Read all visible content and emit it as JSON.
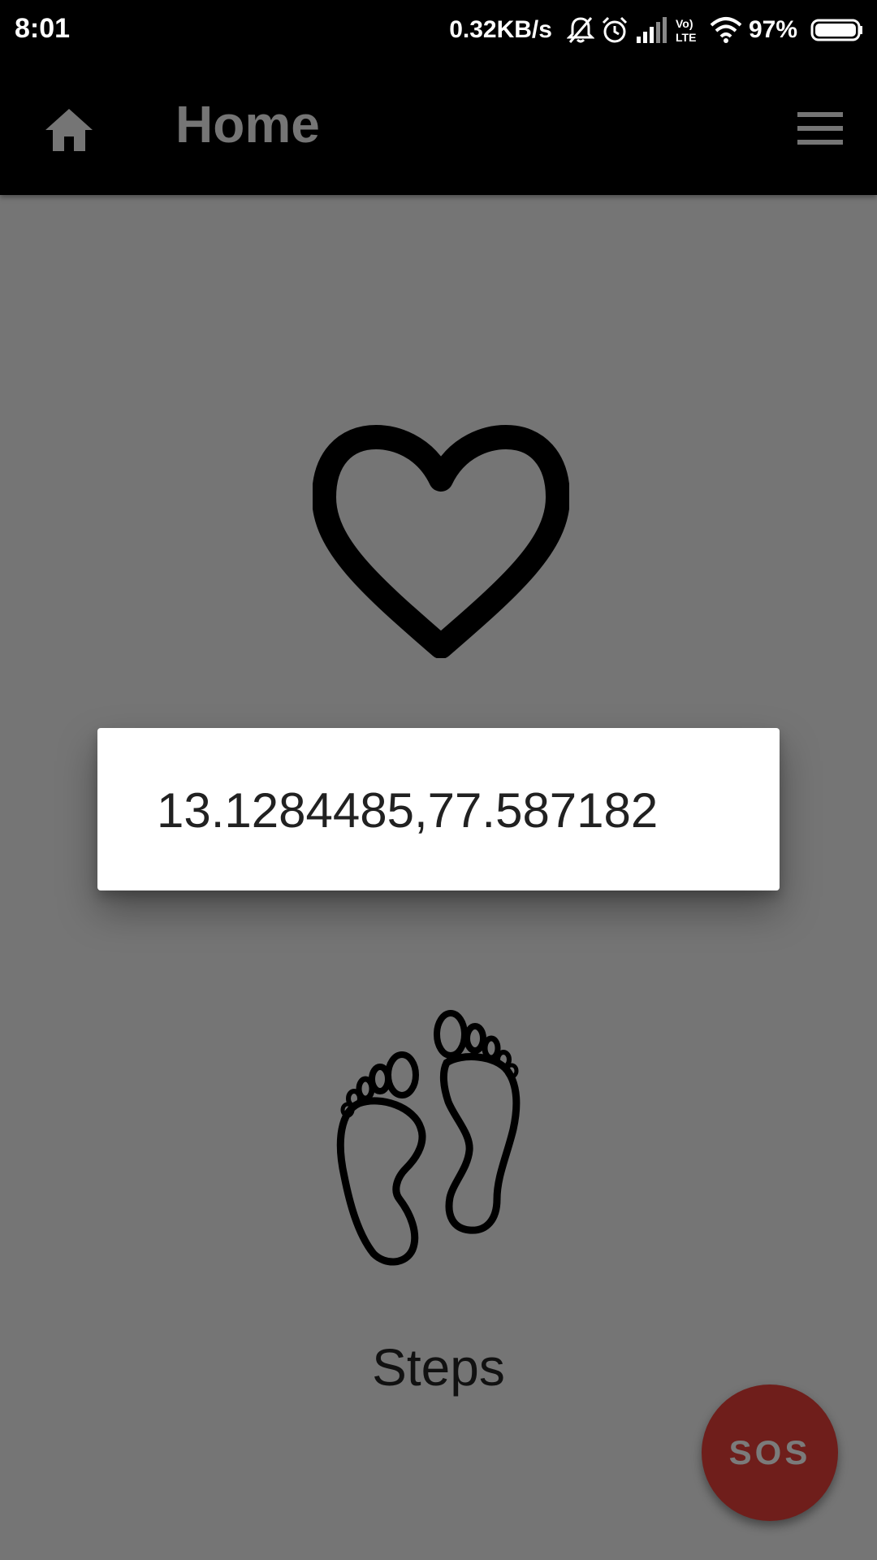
{
  "status_bar": {
    "time": "8:01",
    "network_speed": "0.32KB/s",
    "battery_percent": "97%",
    "volte_top": "Vo)",
    "volte_bottom": "LTE",
    "icons": [
      "muted-bell-icon",
      "alarm-icon",
      "signal-icon",
      "volte-icon",
      "wifi-icon",
      "battery-icon"
    ]
  },
  "app_bar": {
    "title": "Home",
    "home_icon": "home-icon",
    "menu_icon": "hamburger-menu-icon"
  },
  "main": {
    "heart_icon": "heart-icon",
    "location_text": "13.1284485,77.587182",
    "feet_icon": "footprints-icon",
    "steps_label": "Steps"
  },
  "fab": {
    "label": "SOS",
    "color": "#6f1e1b"
  },
  "colors": {
    "background": "#757575",
    "bars": "#000000",
    "card": "#ffffff"
  }
}
